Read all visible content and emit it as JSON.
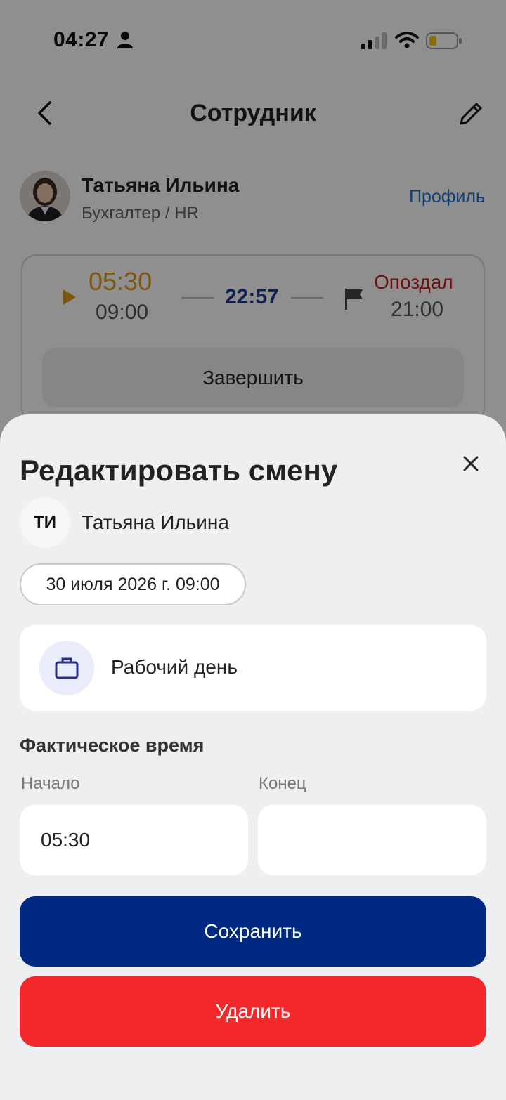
{
  "status_bar": {
    "time": "04:27",
    "icons": [
      "person-icon",
      "signal-icon",
      "wifi-icon",
      "battery-icon"
    ]
  },
  "header": {
    "title": "Сотрудник",
    "back_icon": "chevron-left-icon",
    "edit_icon": "pencil-icon"
  },
  "employee": {
    "name": "Татьяна Ильина",
    "role": "Бухгалтер / HR",
    "profile_link": "Профиль"
  },
  "shift": {
    "start_actual": "05:30",
    "start_planned": "09:00",
    "duration": "22:57",
    "status": "Опоздал",
    "end_planned": "21:00",
    "finish_label": "Завершить"
  },
  "edit_sheet": {
    "title": "Редактировать смену",
    "initials": "ТИ",
    "employee_name": "Татьяна Ильина",
    "date": "30 июля 2026 г. 09:00",
    "shift_type": "Рабочий день",
    "section_title": "Фактическое время",
    "start_label": "Начало",
    "end_label": "Конец",
    "start_value": "05:30",
    "end_value": "",
    "save_label": "Сохранить",
    "delete_label": "Удалить"
  },
  "colors": {
    "primary": "#002a82",
    "danger": "#f2282a",
    "late": "#c91c1c",
    "start_time": "#e39a1e",
    "link": "#1a6fd1",
    "duration": "#1a3a8f"
  }
}
